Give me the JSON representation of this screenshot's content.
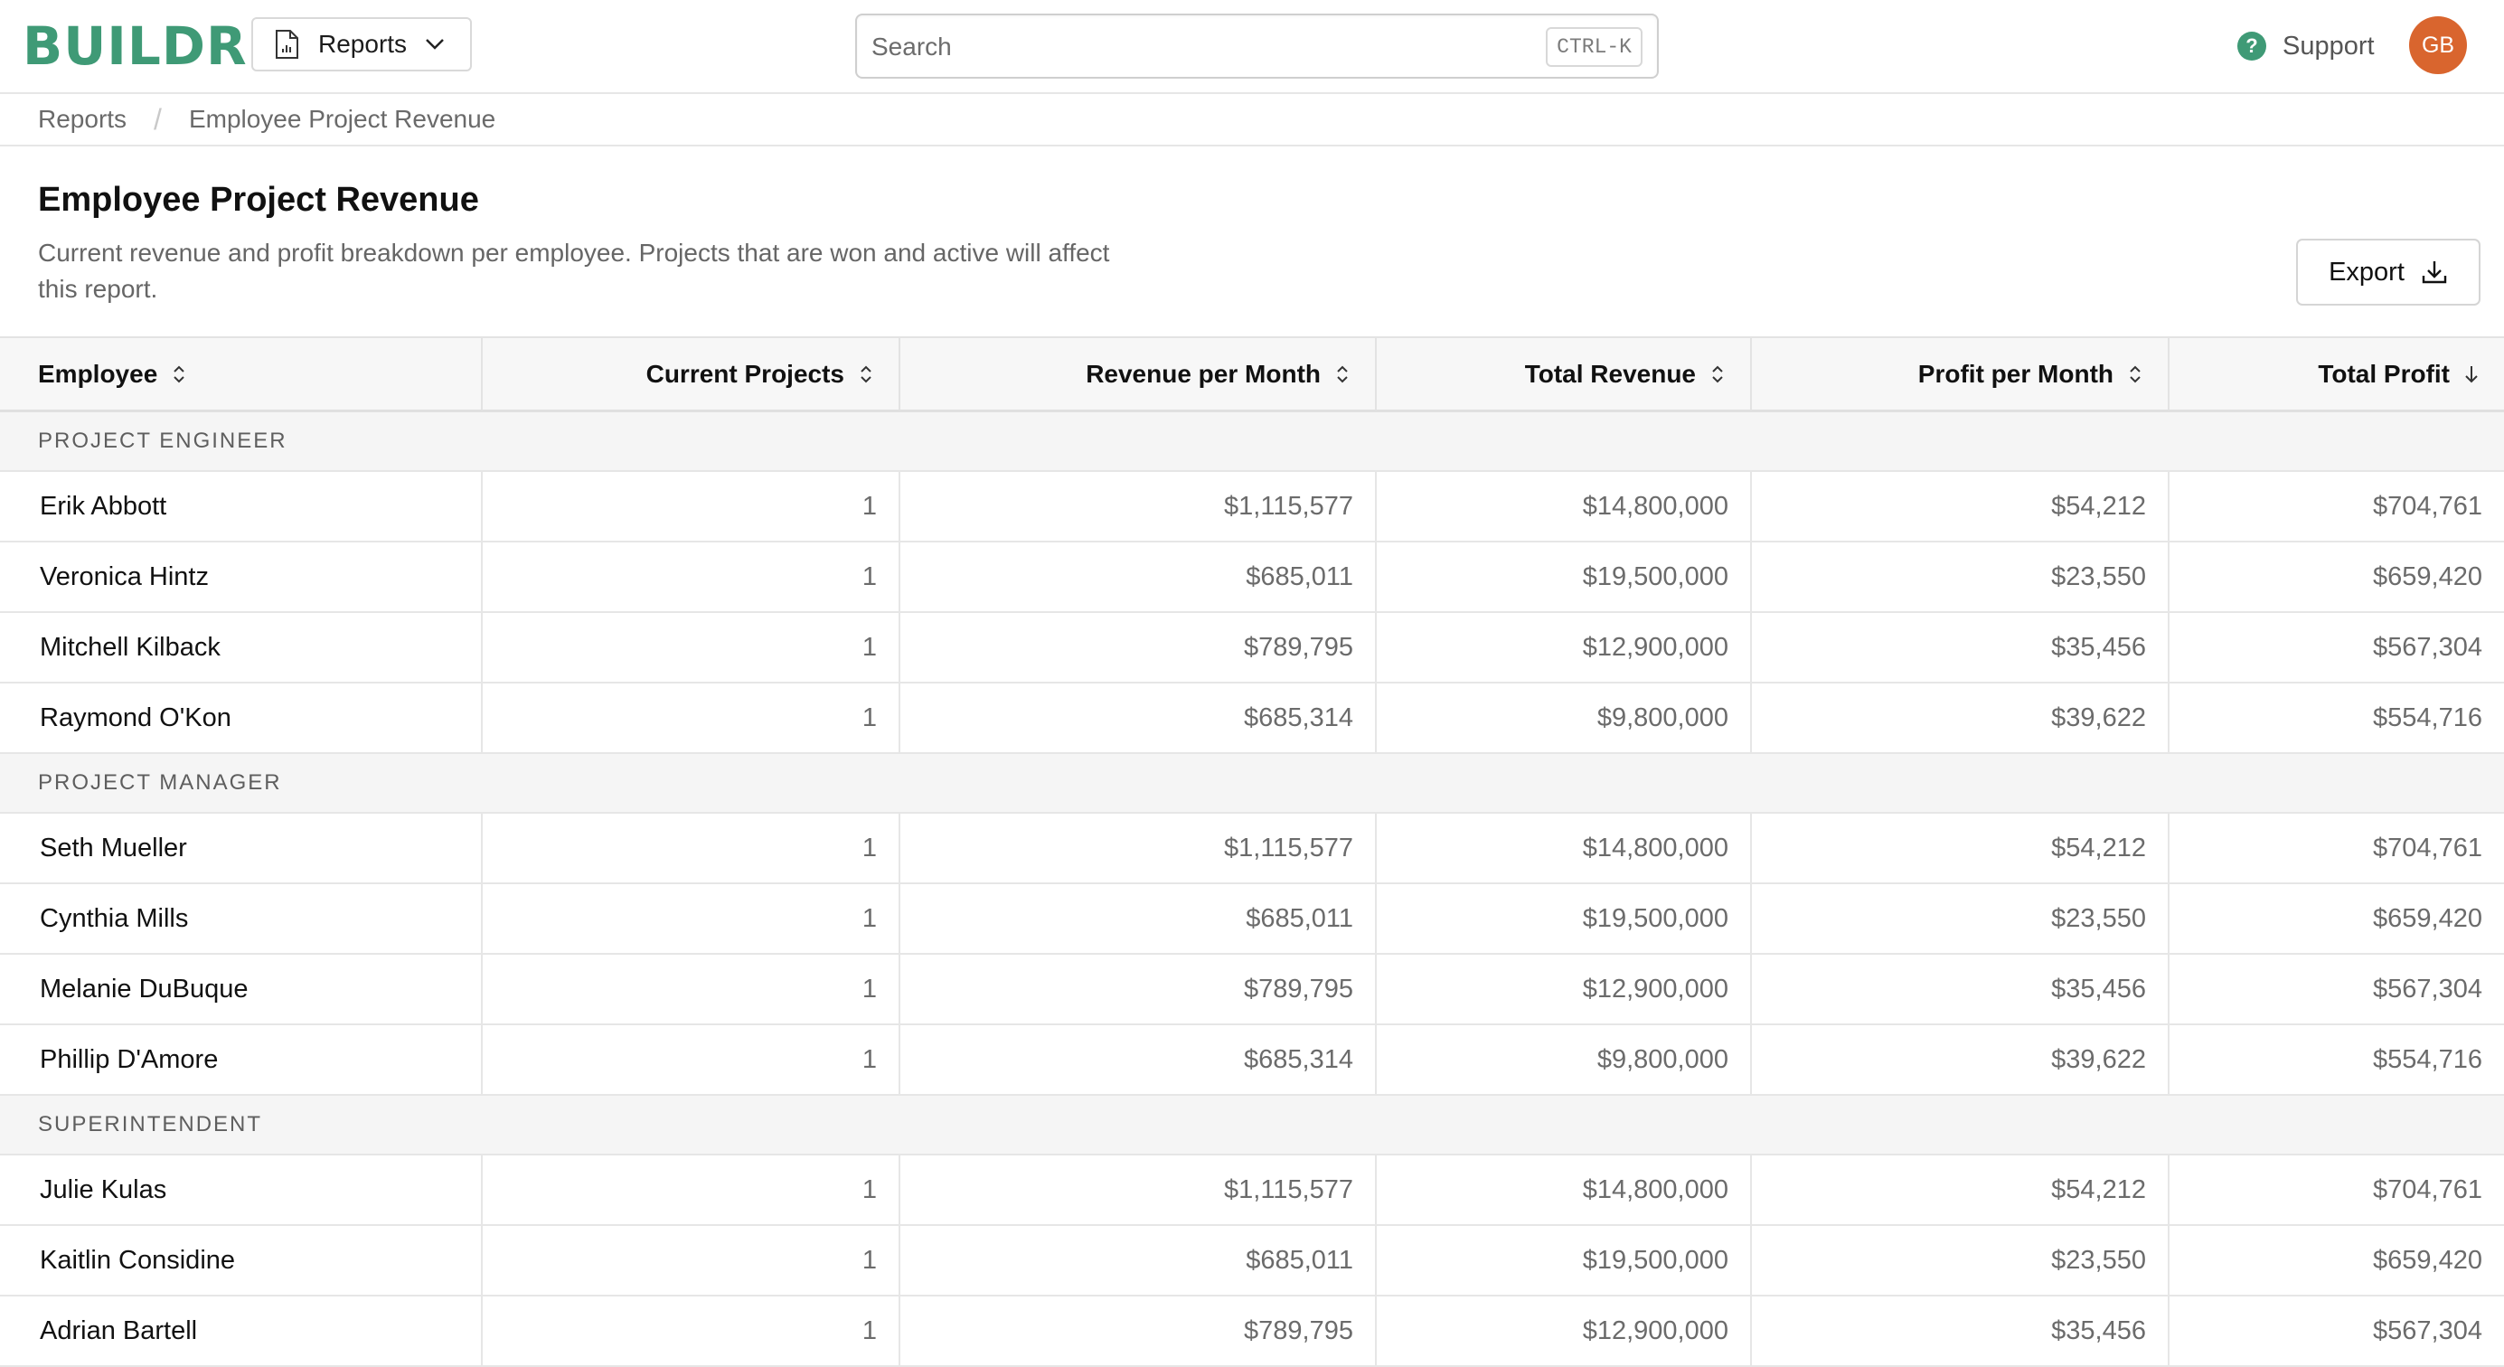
{
  "header": {
    "logo": "BUILDR",
    "reports_label": "Reports",
    "search_placeholder": "Search",
    "search_shortcut": "CTRL-K",
    "support_label": "Support",
    "avatar_initials": "GB"
  },
  "breadcrumb": {
    "root": "Reports",
    "current": "Employee Project Revenue"
  },
  "page": {
    "title": "Employee Project Revenue",
    "description": "Current revenue and profit breakdown per employee. Projects that are won and active will affect this report.",
    "export_label": "Export"
  },
  "table": {
    "columns": [
      "Employee",
      "Current Projects",
      "Revenue per Month",
      "Total Revenue",
      "Profit per Month",
      "Total Profit"
    ],
    "groups": [
      {
        "name": "PROJECT ENGINEER",
        "rows": [
          {
            "employee": "Erik Abbott",
            "projects": "1",
            "rev_month": "$1,115,577",
            "rev_total": "$14,800,000",
            "profit_month": "$54,212",
            "profit_total": "$704,761"
          },
          {
            "employee": "Veronica Hintz",
            "projects": "1",
            "rev_month": "$685,011",
            "rev_total": "$19,500,000",
            "profit_month": "$23,550",
            "profit_total": "$659,420"
          },
          {
            "employee": "Mitchell Kilback",
            "projects": "1",
            "rev_month": "$789,795",
            "rev_total": "$12,900,000",
            "profit_month": "$35,456",
            "profit_total": "$567,304"
          },
          {
            "employee": "Raymond O'Kon",
            "projects": "1",
            "rev_month": "$685,314",
            "rev_total": "$9,800,000",
            "profit_month": "$39,622",
            "profit_total": "$554,716"
          }
        ]
      },
      {
        "name": "PROJECT MANAGER",
        "rows": [
          {
            "employee": "Seth Mueller",
            "projects": "1",
            "rev_month": "$1,115,577",
            "rev_total": "$14,800,000",
            "profit_month": "$54,212",
            "profit_total": "$704,761"
          },
          {
            "employee": "Cynthia Mills",
            "projects": "1",
            "rev_month": "$685,011",
            "rev_total": "$19,500,000",
            "profit_month": "$23,550",
            "profit_total": "$659,420"
          },
          {
            "employee": "Melanie DuBuque",
            "projects": "1",
            "rev_month": "$789,795",
            "rev_total": "$12,900,000",
            "profit_month": "$35,456",
            "profit_total": "$567,304"
          },
          {
            "employee": "Phillip D'Amore",
            "projects": "1",
            "rev_month": "$685,314",
            "rev_total": "$9,800,000",
            "profit_month": "$39,622",
            "profit_total": "$554,716"
          }
        ]
      },
      {
        "name": "SUPERINTENDENT",
        "rows": [
          {
            "employee": "Julie Kulas",
            "projects": "1",
            "rev_month": "$1,115,577",
            "rev_total": "$14,800,000",
            "profit_month": "$54,212",
            "profit_total": "$704,761"
          },
          {
            "employee": "Kaitlin Considine",
            "projects": "1",
            "rev_month": "$685,011",
            "rev_total": "$19,500,000",
            "profit_month": "$23,550",
            "profit_total": "$659,420"
          },
          {
            "employee": "Adrian Bartell",
            "projects": "1",
            "rev_month": "$789,795",
            "rev_total": "$12,900,000",
            "profit_month": "$35,456",
            "profit_total": "$567,304"
          }
        ]
      }
    ]
  },
  "colors": {
    "brand": "#3f9a76",
    "avatar": "#d9652e"
  }
}
